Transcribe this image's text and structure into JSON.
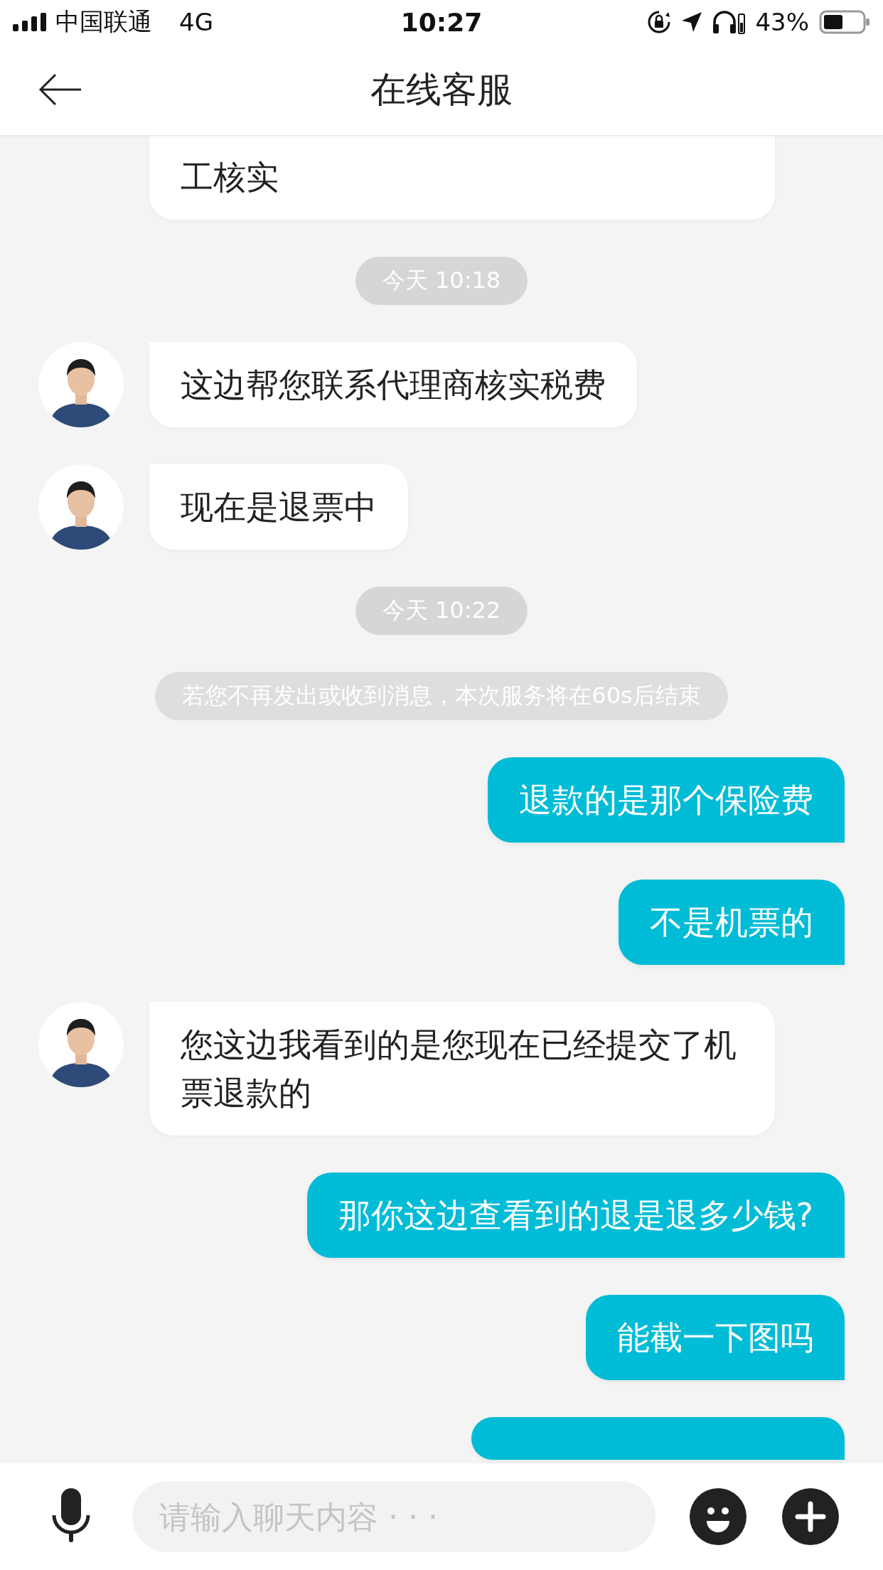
{
  "status_bar": {
    "carrier": "中国联通",
    "network": "4G",
    "time": "10:27",
    "battery": "43%"
  },
  "header": {
    "title": "在线客服"
  },
  "messages": [
    {
      "kind": "agent_cut",
      "text": "工核实"
    },
    {
      "kind": "time",
      "text": "今天 10:18"
    },
    {
      "kind": "agent",
      "text": "这边帮您联系代理商核实税费"
    },
    {
      "kind": "agent",
      "text": "现在是退票中"
    },
    {
      "kind": "time",
      "text": "今天 10:22"
    },
    {
      "kind": "notice",
      "text": "若您不再发出或收到消息，本次服务将在60s后结束"
    },
    {
      "kind": "user",
      "text": "退款的是那个保险费"
    },
    {
      "kind": "user",
      "text": "不是机票的"
    },
    {
      "kind": "agent",
      "text": "您这边我看到的是您现在已经提交了机票退款的"
    },
    {
      "kind": "user",
      "text": "那你这边查看到的退是退多少钱?"
    },
    {
      "kind": "user",
      "text": "能截一下图吗"
    },
    {
      "kind": "user_cut"
    }
  ],
  "input": {
    "placeholder": "请输入聊天内容 · · ·"
  }
}
